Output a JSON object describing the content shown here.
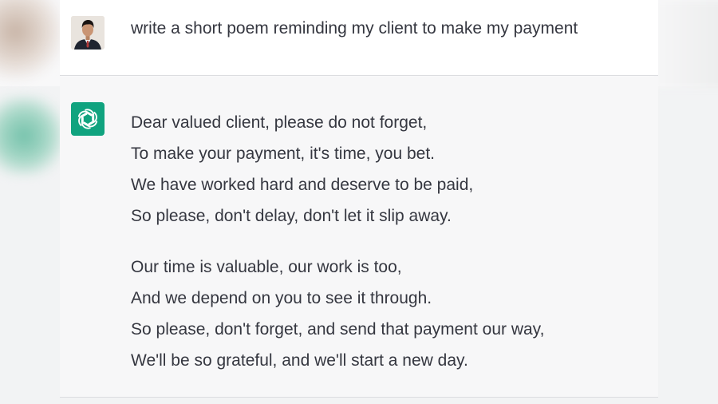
{
  "conversation": {
    "user_message": "write a short poem reminding my client to make my payment",
    "assistant_stanzas": [
      {
        "lines": [
          "Dear valued client, please do not forget,",
          "To make your payment, it's time, you bet.",
          "We have worked hard and deserve to be paid,",
          "So please, don't delay, don't let it slip away."
        ]
      },
      {
        "lines": [
          "Our time is valuable, our work is too,",
          "And we depend on you to see it through.",
          "So please, don't forget, and send that payment our way,",
          "We'll be so grateful, and we'll start a new day."
        ]
      }
    ]
  },
  "icons": {
    "user_avatar": "user-avatar-photo",
    "assistant_avatar": "openai-logo-icon"
  },
  "colors": {
    "assistant_avatar_bg": "#10a37f",
    "text": "#353740",
    "assistant_turn_bg": "#f7f7f8",
    "user_turn_bg": "#ffffff"
  }
}
